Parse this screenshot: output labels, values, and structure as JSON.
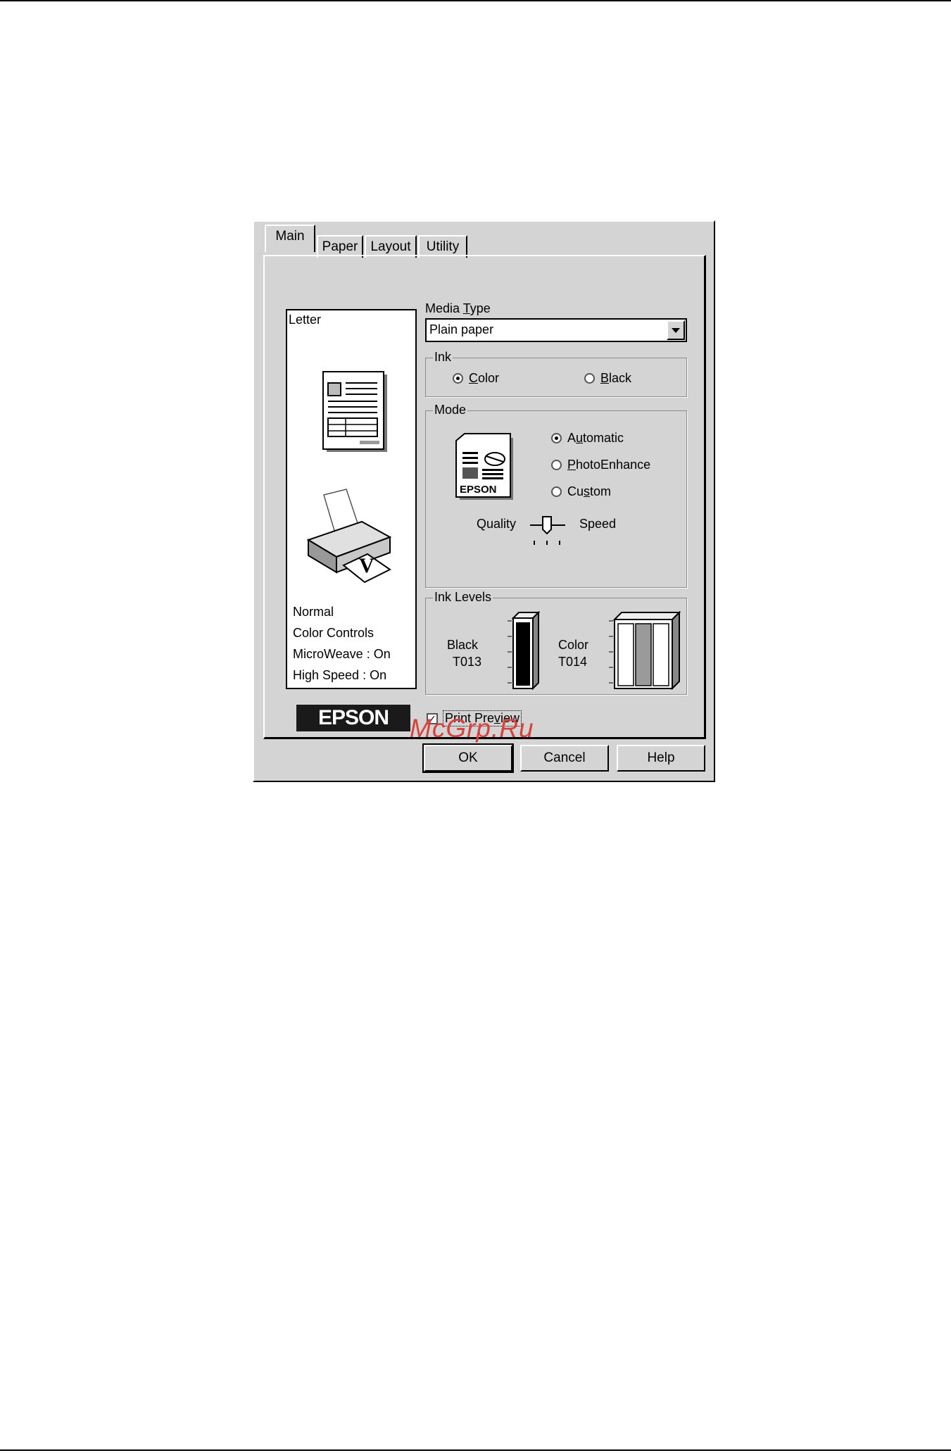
{
  "tabs": [
    "Main",
    "Paper",
    "Layout",
    "Utility"
  ],
  "preview": {
    "paper_size": "Letter",
    "settings": [
      "Normal",
      "Color Controls",
      "MicroWeave : On",
      "High Speed : On"
    ]
  },
  "media_type": {
    "label_pre": "Media ",
    "label_key": "T",
    "label_post": "ype",
    "value": "Plain paper"
  },
  "ink": {
    "title": "Ink",
    "color": {
      "key": "C",
      "rest": "olor",
      "selected": true
    },
    "black": {
      "key": "B",
      "rest": "lack",
      "selected": false
    }
  },
  "mode": {
    "title": "Mode",
    "automatic": {
      "pre": "A",
      "key": "u",
      "rest": "tomatic",
      "selected": true
    },
    "photoenhance": {
      "pre": "",
      "key": "P",
      "rest": "hotoEnhance",
      "selected": false
    },
    "custom": {
      "pre": "Cu",
      "key": "s",
      "rest": "tom",
      "selected": false
    },
    "quality_label": "Quality",
    "speed_label": "Speed",
    "icon_text": "EPSON"
  },
  "ink_levels": {
    "title": "Ink Levels",
    "black_name": "Black",
    "black_code": "T013",
    "color_name": "Color",
    "color_code": "T014"
  },
  "print_preview": {
    "pre": "Print Pre",
    "key": "v",
    "rest": "iew",
    "checked": true
  },
  "brand": "EPSON",
  "buttons": {
    "ok": "OK",
    "cancel": "Cancel",
    "help": "Help"
  },
  "watermark": "McGrp.Ru"
}
